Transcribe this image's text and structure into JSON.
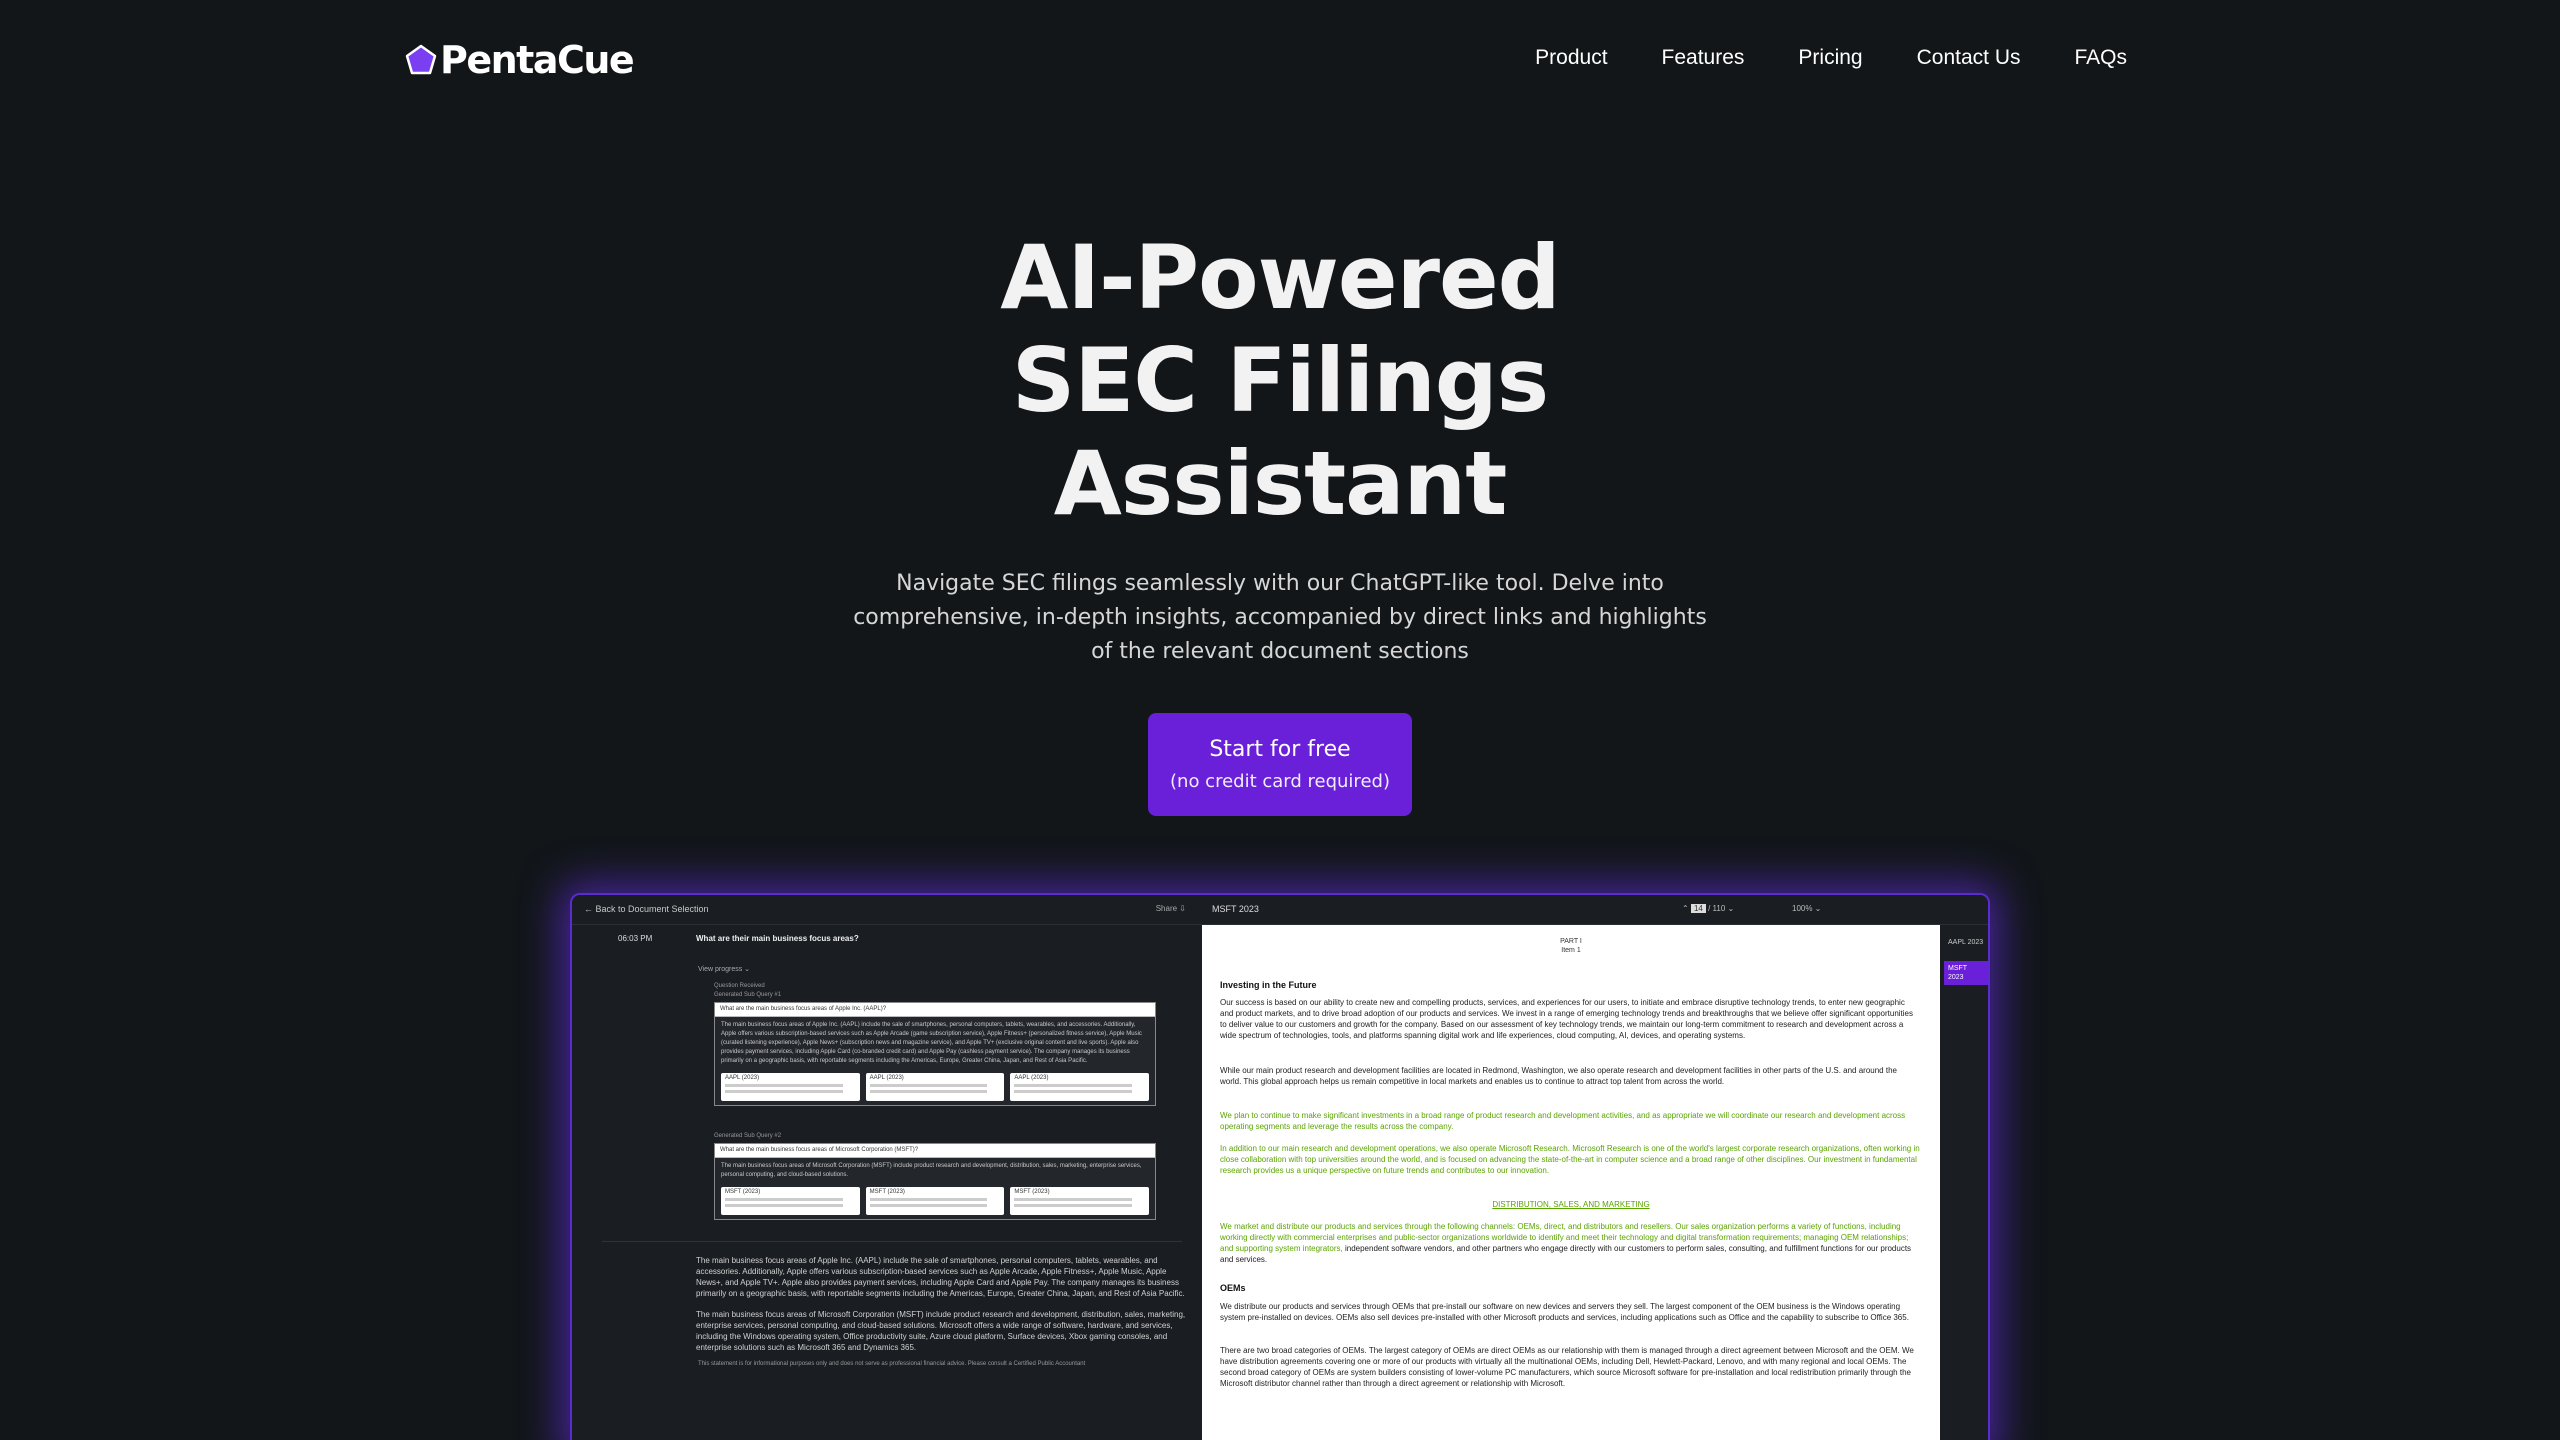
{
  "brand": {
    "name": "PentaCue",
    "color": "#6a1fd8"
  },
  "nav": {
    "items": [
      "Product",
      "Features",
      "Pricing",
      "Contact Us",
      "FAQs"
    ]
  },
  "hero": {
    "title_lines": [
      "AI-Powered",
      "SEC Filings",
      "Assistant"
    ],
    "subtitle": "Navigate SEC filings seamlessly with our ChatGPT-like tool. Delve into comprehensive, in-depth insights, accompanied by direct links and highlights of the relevant document sections",
    "cta_label": "Start for free",
    "cta_sublabel": "(no credit card required)"
  },
  "preview": {
    "back_label": "← Back to Document Selection",
    "share_label": "Share ⇩",
    "time": "06:03 PM",
    "question": "What are their main business focus areas?",
    "view_progress": "View progress ⌄",
    "question_received": "Question Received",
    "subquery1_label": "Generated Sub Query #1",
    "subquery1_q": "What are the main business focus areas of Apple Inc. (AAPL)?",
    "subquery1_a": "The main business focus areas of Apple Inc. (AAPL) include the sale of smartphones, personal computers, tablets, wearables, and accessories. Additionally, Apple offers various subscription-based services such as Apple Arcade (game subscription service), Apple Fitness+ (personalized fitness service), Apple Music (curated listening experience), Apple News+ (subscription news and magazine service), and Apple TV+ (exclusive original content and live sports). Apple also provides payment services, including Apple Card (co-branded credit card) and Apple Pay (cashless payment service). The company manages its business primarily on a geographic basis, with reportable segments including the Americas, Europe, Greater China, Japan, and Rest of Asia Pacific.",
    "subquery1_cites": [
      "AAPL (2023)",
      "AAPL (2023)",
      "AAPL (2023)"
    ],
    "subquery2_label": "Generated Sub Query #2",
    "subquery2_q": "What are the main business focus areas of Microsoft Corporation (MSFT)?",
    "subquery2_a": "The main business focus areas of Microsoft Corporation (MSFT) include product research and development, distribution, sales, marketing, enterprise services, personal computing, and cloud-based solutions.",
    "subquery2_cites": [
      "MSFT (2023)",
      "MSFT (2023)",
      "MSFT (2023)"
    ],
    "answer1": "The main business focus areas of Apple Inc. (AAPL) include the sale of smartphones, personal computers, tablets, wearables, and accessories. Additionally, Apple offers various subscription-based services such as Apple Arcade, Apple Fitness+, Apple Music, Apple News+, and Apple TV+. Apple also provides payment services, including Apple Card and Apple Pay. The company manages its business primarily on a geographic basis, with reportable segments including the Americas, Europe, Greater China, Japan, and Rest of Asia Pacific.",
    "answer2": "The main business focus areas of Microsoft Corporation (MSFT) include product research and development, distribution, sales, marketing, enterprise services, personal computing, and cloud-based solutions. Microsoft offers a wide range of software, hardware, and services, including the Windows operating system, Office productivity suite, Azure cloud platform, Surface devices, Xbox gaming consoles, and enterprise solutions such as Microsoft 365 and Dynamics 365.",
    "disclaimer": "This statement is for informational purposes only and does not serve as professional financial advice. Please consult a Certified Public Accountant",
    "doc_name": "MSFT 2023",
    "doc_page_current": "14",
    "doc_page_total": "/ 110",
    "doc_zoom": "100% ⌄",
    "doc_part": "PART I",
    "doc_item": "Item 1",
    "doc_heading1": "Investing in the Future",
    "doc_p1": "Our success is based on our ability to create new and compelling products, services, and experiences for our users, to initiate and embrace disruptive technology trends, to enter new geographic and product markets, and to drive broad adoption of our products and services. We invest in a range of emerging technology trends and breakthroughs that we believe offer significant opportunities to deliver value to our customers and growth for the company. Based on our assessment of key technology trends, we maintain our long-term commitment to research and development across a wide spectrum of technologies, tools, and platforms spanning digital work and life experiences, cloud computing, AI, devices, and operating systems.",
    "doc_p2": "While our main product research and development facilities are located in Redmond, Washington, we also operate research and development facilities in other parts of the U.S. and around the world. This global approach helps us remain competitive in local markets and enables us to continue to attract top talent from across the world.",
    "doc_p3": "We plan to continue to make significant investments in a broad range of product research and development activities, and as appropriate we will coordinate our research and development across operating segments and leverage the results across the company.",
    "doc_p4": "In addition to our main research and development operations, we also operate Microsoft Research. Microsoft Research is one of the world's largest corporate research organizations, often working in close collaboration with top universities around the world, and is focused on advancing the state-of-the-art in computer science and a broad range of other disciplines. Our investment in fundamental research provides us a unique perspective on future trends and contributes to our innovation.",
    "doc_section": "DISTRIBUTION, SALES, AND MARKETING",
    "doc_p5": "We market and distribute our products and services through the following channels: OEMs, direct, and distributors and resellers. Our sales organization performs a variety of functions, including working directly with commercial enterprises and public-sector organizations worldwide to identify and meet their technology and digital transformation requirements; managing OEM relationships; and supporting system integrators,",
    "doc_p5_rest": "independent software vendors, and other partners who engage directly with our customers to perform sales, consulting, and fulfillment functions for our products and services.",
    "doc_heading2": "OEMs",
    "doc_p6": "We distribute our products and services through OEMs that pre-install our software on new devices and servers they sell. The largest component of the OEM business is the Windows operating system pre-installed on devices. OEMs also sell devices pre-installed with other Microsoft products and services, including applications such as Office and the capability to subscribe to Office 365.",
    "doc_p7": "There are two broad categories of OEMs. The largest category of OEMs are direct OEMs as our relationship with them is managed through a direct agreement between Microsoft and the OEM. We have distribution agreements covering one or more of our products with virtually all the multinational OEMs, including Dell, Hewlett-Packard, Lenovo, and with many regional and local OEMs. The second broad category of OEMs are system builders consisting of lower-volume PC manufacturers, which source Microsoft software for pre-installation and local redistribution primarily through the Microsoft distributor channel rather than through a direct agreement or relationship with Microsoft.",
    "sidebar_docs": [
      "AAPL 2023",
      "MSFT 2023"
    ]
  }
}
